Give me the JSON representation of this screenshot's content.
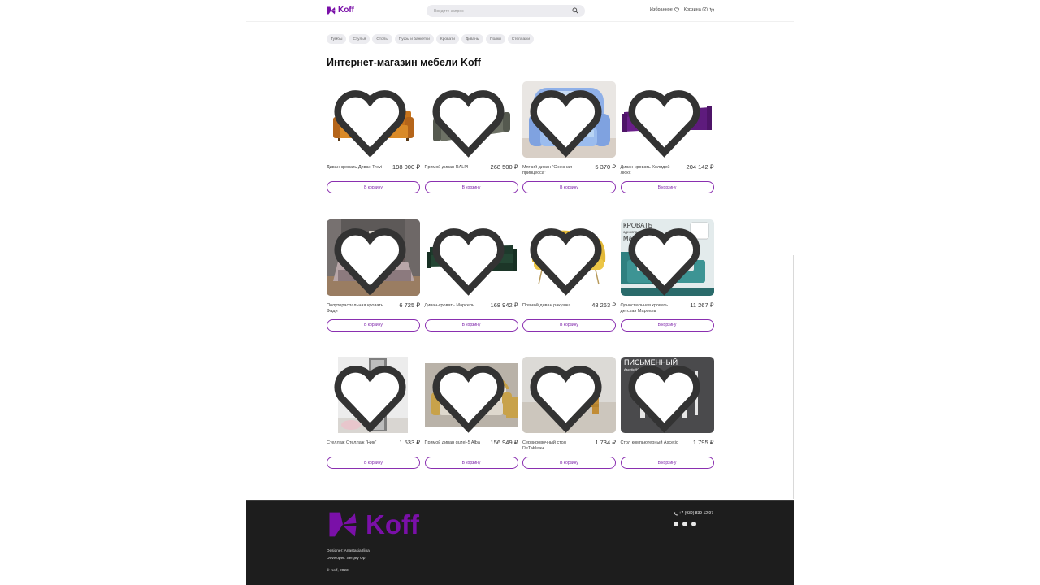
{
  "header": {
    "logo_text": "Koff",
    "search_placeholder": "Введите запрос",
    "favorites_label": "Избранное",
    "cart_label": "Корзина (2)"
  },
  "categories": [
    "Тумбы",
    "Стулья",
    "Столы",
    "Пуфы и банкетки",
    "Кровати",
    "Диваны",
    "Полки",
    "Стеллажи"
  ],
  "page_title": "Интернет-магазин мебели Koff",
  "products": [
    {
      "name": "Диван-кровать Диван Trevi",
      "price": "198 000 ₽",
      "button": "В корзину",
      "image": "orange-sofa"
    },
    {
      "name": "Прямой диван RALPH",
      "price": "268 500 ₽",
      "button": "В корзину",
      "image": "grey-sofa"
    },
    {
      "name": "Мягкий диван \"Снежная принцесса\"",
      "price": "5 370 ₽",
      "button": "В корзину",
      "image": "kids-sofa"
    },
    {
      "name": "Диван-кровать Холидей Люкс",
      "price": "204 142 ₽",
      "button": "В корзину",
      "image": "purple-corner-sofa"
    },
    {
      "name": "Полутораспальная кровать Фади",
      "price": "6 725 ₽",
      "button": "В корзину",
      "image": "bedroom"
    },
    {
      "name": "Диван-кровать Марсель",
      "price": "168 942 ₽",
      "button": "В корзину",
      "image": "green-corner-sofa"
    },
    {
      "name": "Прямой диван ракушка",
      "price": "48 263 ₽",
      "button": "В корзину",
      "image": "yellow-shell-sofa"
    },
    {
      "name": "Односпальная кровать детская Марсель",
      "price": "11 267 ₽",
      "button": "В корзину",
      "image": "kids-bed"
    },
    {
      "name": "Стеллаж Стеллаж \"Ник\"",
      "price": "1 533 ₽",
      "button": "В корзину",
      "image": "shelf"
    },
    {
      "name": "Прямой диван guzel-5 Alba",
      "price": "156 949 ₽",
      "button": "В корзину",
      "image": "classic-sofa"
    },
    {
      "name": "Сервировочный стол ReTableau",
      "price": "1 734 ₽",
      "button": "В корзину",
      "image": "coffee-table"
    },
    {
      "name": "Стол компьютерный Ascetic",
      "price": "1 795 ₽",
      "button": "В корзину",
      "image": "computer-desk"
    }
  ],
  "image_text": {
    "kids_bed_line1": "КРОВАТЬ",
    "kids_bed_line2": "односпальная",
    "kids_bed_line3": "Марсель",
    "desk_line1": "ПИСЬМЕННЫЙ",
    "desk_line2": "Ascetic 900"
  },
  "footer": {
    "logo_text": "Koff",
    "designer": "Designer: Anastasia Ilina",
    "developer": "Developer: Sergey Op",
    "copyright": "© Koff, 2023",
    "phone": "+7 (939) 839 12 97"
  },
  "colors": {
    "brand": "#7a10a8",
    "footer_bg": "#1d1d1d",
    "button_border": "#8a2fb0"
  }
}
